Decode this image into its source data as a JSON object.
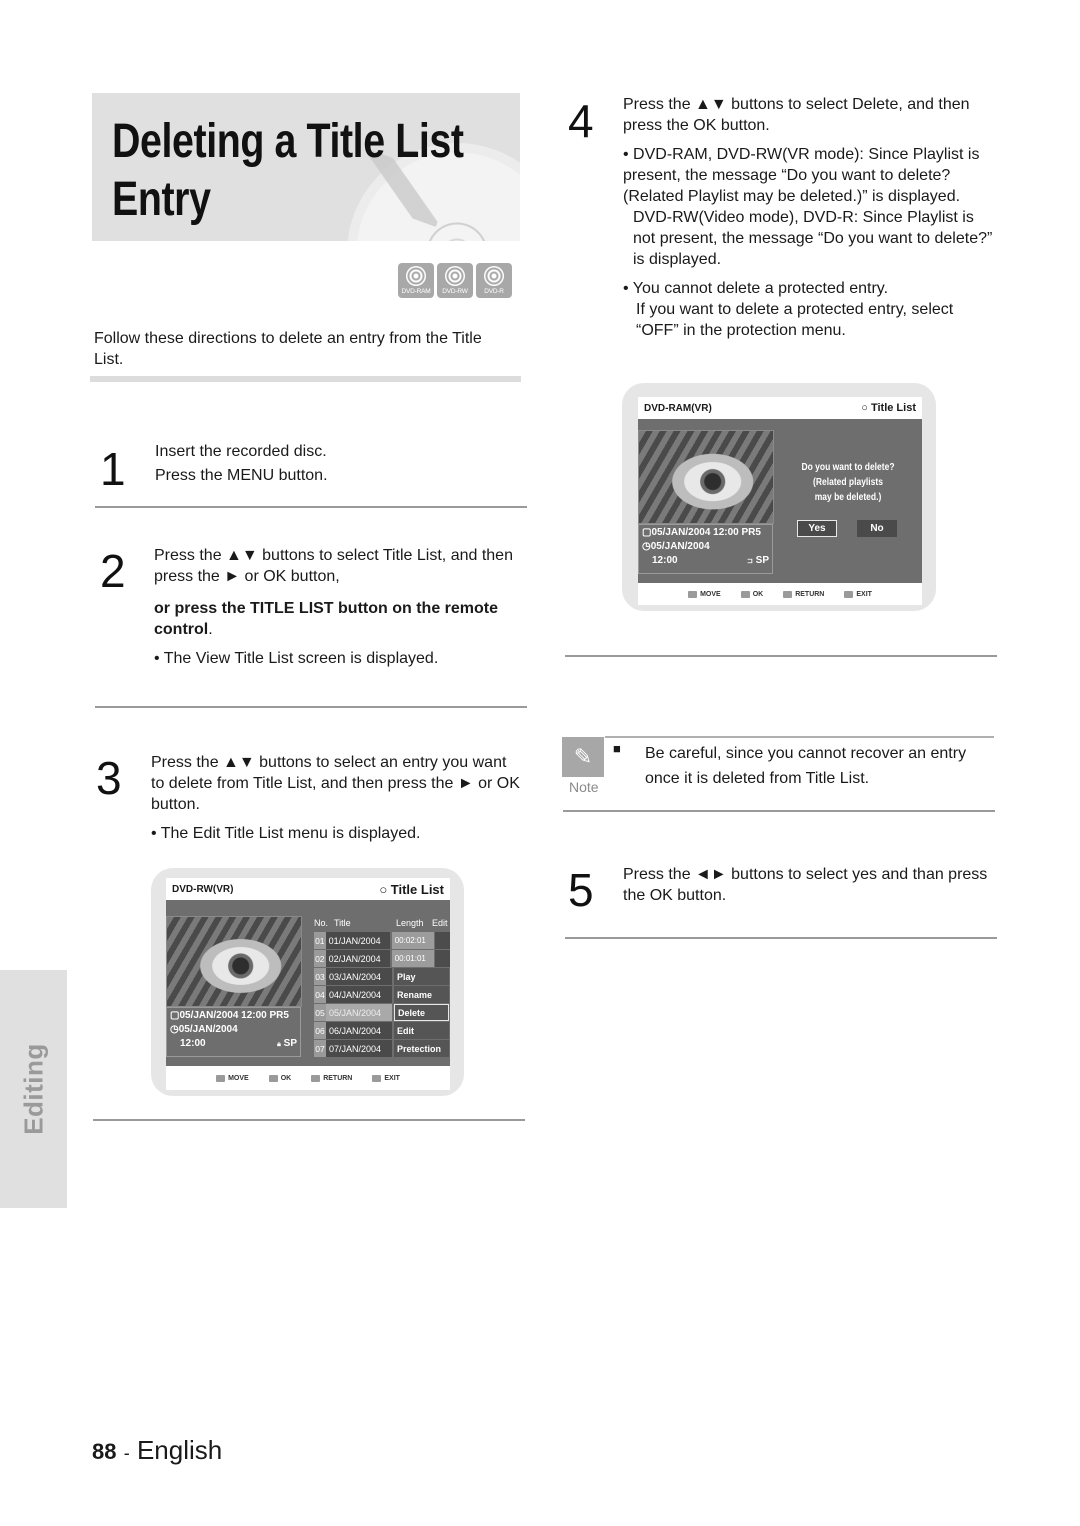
{
  "page": {
    "title_line1": "Deleting a Title List",
    "title_line2": "Entry",
    "disc_badges": [
      "DVD-RAM",
      "DVD-RW",
      "DVD-R"
    ],
    "intro": "Follow these directions to delete an entry from the Title List.",
    "side_tab": "Editing",
    "page_number": "88",
    "separator": "-",
    "language": "English"
  },
  "steps": [
    {
      "number": "1",
      "lines": [
        "Insert the recorded disc.",
        "Press the MENU button."
      ]
    },
    {
      "number": "2",
      "text": "Press the ▲▼ buttons to select Title List, and then press the ► or OK button,",
      "bold_text": "or press the TITLE LIST button on the remote control",
      "bold_suffix": ".",
      "bullet": "• The View Title List screen is displayed."
    },
    {
      "number": "3",
      "text": "Press the ▲▼ buttons to select an entry you want to delete from Title List, and then press the ► or OK button.",
      "bullet": "• The Edit Title List menu is displayed."
    },
    {
      "number": "4",
      "text": "Press the ▲▼ buttons to select Delete, and then press the OK button.",
      "bullet1": "• DVD-RAM, DVD-RW(VR mode): Since Playlist is present, the message “Do you want to delete? (Related Playlist may be deleted.)” is displayed.",
      "bullet1b": "DVD-RW(Video mode), DVD-R: Since Playlist is not present, the message “Do you want to delete?” is displayed.",
      "bullet2": "• You cannot delete a protected entry.",
      "bullet2b": "If you want to delete a protected entry, select “OFF” in the protection menu."
    },
    {
      "number": "5",
      "text": "Press the ◄► buttons to select yes and than press the OK button."
    }
  ],
  "note": {
    "label": "Note",
    "bullet": "■",
    "text": "Be careful, since you cannot recover an entry once it is deleted from Title List."
  },
  "screen_title_list": {
    "disc": "DVD-RW(VR)",
    "title": "○ Title List",
    "info_line1": "05/JAN/2004 12:00 PR5",
    "info_line2": "05/JAN/2004",
    "info_time": "12:00",
    "info_mode": "SP",
    "columns": [
      "No.",
      "Title",
      "Length",
      "Edit"
    ],
    "rows": [
      {
        "no": "01",
        "title": "01/JAN/2004",
        "length": "00:02:01"
      },
      {
        "no": "02",
        "title": "02/JAN/2004",
        "length": "00:01:01"
      },
      {
        "no": "03",
        "title": "03/JAN/2004",
        "menu": "Play"
      },
      {
        "no": "04",
        "title": "04/JAN/2004",
        "menu": "Rename"
      },
      {
        "no": "05",
        "title": "05/JAN/2004",
        "menu": "Delete"
      },
      {
        "no": "06",
        "title": "06/JAN/2004",
        "menu": "Edit"
      },
      {
        "no": "07",
        "title": "07/JAN/2004",
        "menu": "Pretection"
      }
    ],
    "footer": [
      "MOVE",
      "OK",
      "RETURN",
      "EXIT"
    ]
  },
  "screen_delete_dialog": {
    "disc": "DVD-RAM(VR)",
    "title": "○ Title List",
    "info_line1": "05/JAN/2004 12:00 PR5",
    "info_line2": "05/JAN/2004",
    "info_time": "12:00",
    "info_mode": "SP",
    "message_line1": "Do you want to delete?",
    "message_line2": "(Related playlists",
    "message_line3": "may be deleted.)",
    "yes": "Yes",
    "no": "No",
    "footer": [
      "MOVE",
      "OK",
      "RETURN",
      "EXIT"
    ]
  }
}
